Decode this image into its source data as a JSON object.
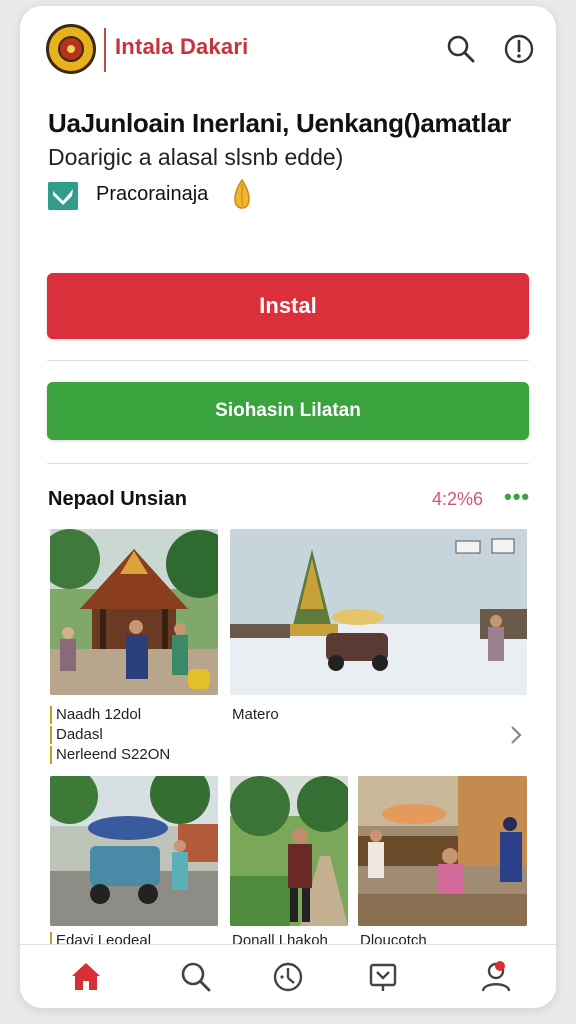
{
  "header": {
    "app_title": "Intala Dakari",
    "logo": "seal-logo",
    "icons": [
      "search-icon",
      "info-icon"
    ]
  },
  "app": {
    "name": "UaJunloain Inerlani, Uenkang()amatlar",
    "subtitle": "Doarigic a alasal slsnb edde)",
    "developer": "Pracorainaja",
    "developer_icon": "developer-badge-icon",
    "badge_icon": "hand-icon"
  },
  "buttons": {
    "install_label": "Instal",
    "secondary_label": "Siohasin Lilatan"
  },
  "gallery": {
    "title": "Nepaol Unsian",
    "meta": "4:2%6",
    "more_icon": "more-dots-icon",
    "captions": {
      "row1_left": [
        "Naadh 12dol",
        "Dadasl",
        "Nerleend S22ON"
      ],
      "row1_right": "Matero",
      "row2": [
        "Edayi Leodeal",
        "Donall Lhakoh",
        "Dloucotch"
      ]
    },
    "next_icon": "chevron-right-icon"
  },
  "nav": {
    "items": [
      "home-icon",
      "search-icon",
      "navigate-icon",
      "message-icon",
      "profile-icon"
    ],
    "active": "home-icon"
  },
  "colors": {
    "accent_red": "#db2f3c",
    "accent_green": "#3aa33e",
    "title_red": "#c8323a",
    "meta_pink": "#d0567a"
  }
}
